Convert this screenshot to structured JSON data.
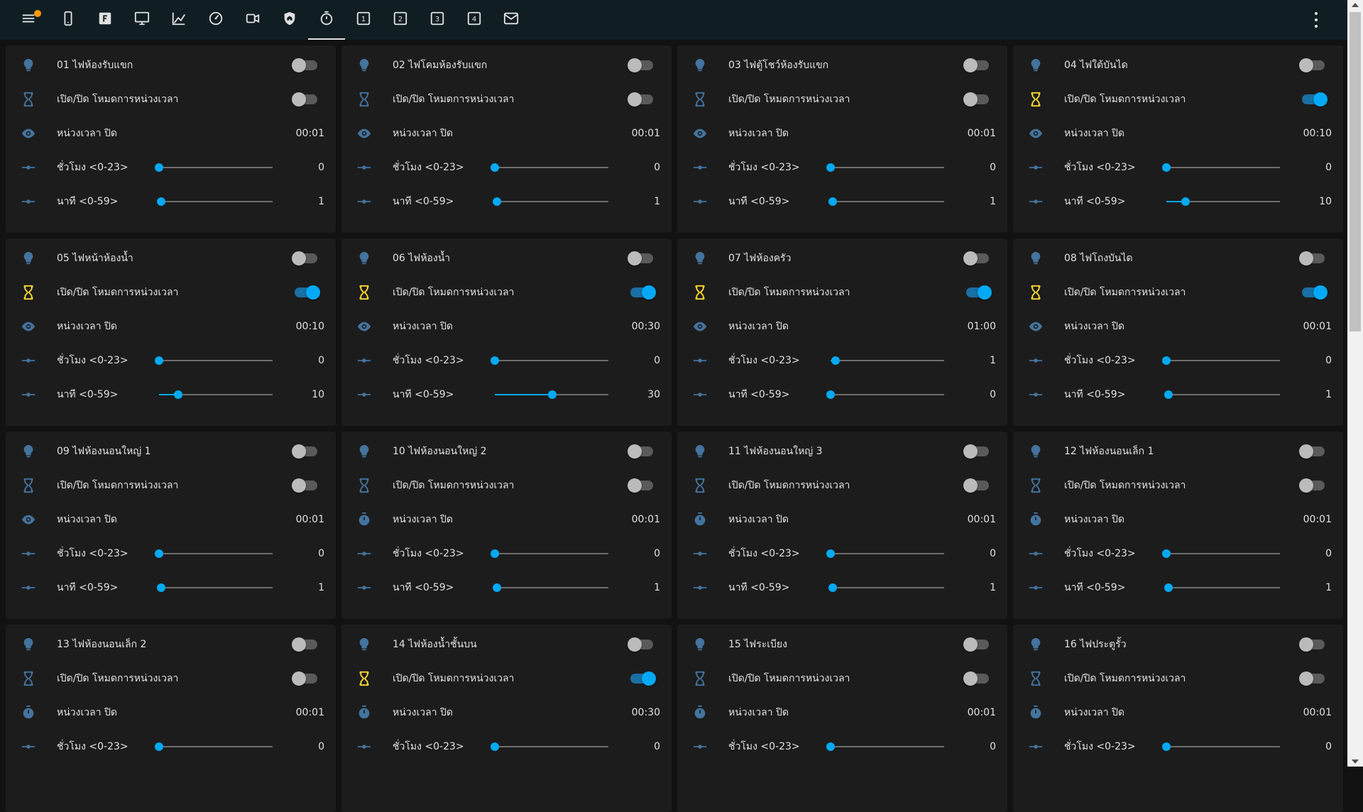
{
  "colors": {
    "accent": "#03a9f4",
    "icon": "#44739e",
    "icon_active": "#fdd835",
    "header_bg": "#101e24",
    "card_bg": "#1c1c1c"
  },
  "toolbar": {
    "menu_icon": "menu-icon",
    "tabs": [
      {
        "icon": "cellphone-icon"
      },
      {
        "icon": "alpha-f-box-icon"
      },
      {
        "icon": "monitor-icon"
      },
      {
        "icon": "chart-line-icon"
      },
      {
        "icon": "gauge-icon"
      },
      {
        "icon": "video-camera-icon"
      },
      {
        "icon": "shield-home-icon"
      },
      {
        "icon": "timer-icon",
        "active": true
      },
      {
        "icon": "numeric-1-box-icon",
        "digit": "1"
      },
      {
        "icon": "numeric-2-box-icon",
        "digit": "2"
      },
      {
        "icon": "numeric-3-box-icon",
        "digit": "3"
      },
      {
        "icon": "numeric-4-box-icon",
        "digit": "4"
      },
      {
        "icon": "email-icon"
      }
    ],
    "overflow_icon": "dots-vertical-icon"
  },
  "labels": {
    "timer_mode": "เปิด/ปิด โหมดการหน่วงเวลา",
    "delay_off": "หน่วงเวลา ปิด",
    "hours": "ชั่วโมง <0-23>",
    "minutes": "นาที <0-59>"
  },
  "cards": [
    {
      "title": "01 ไฟห้องรับแขก",
      "light_on": false,
      "timer_on": false,
      "delay_icon": "eye-icon",
      "delay": "00:01",
      "hours": 0,
      "minutes": 1
    },
    {
      "title": "02 ไฟโคมห้องรับแขก",
      "light_on": false,
      "timer_on": false,
      "delay_icon": "eye-icon",
      "delay": "00:01",
      "hours": 0,
      "minutes": 1
    },
    {
      "title": "03 ไฟตู้โชว์ห้องรับแขก",
      "light_on": false,
      "timer_on": false,
      "delay_icon": "eye-icon",
      "delay": "00:01",
      "hours": 0,
      "minutes": 1
    },
    {
      "title": "04 ไฟใต้บันได",
      "light_on": false,
      "timer_on": true,
      "delay_icon": "eye-icon",
      "delay": "00:10",
      "hours": 0,
      "minutes": 10
    },
    {
      "title": "05 ไฟหน้าห้องน้ำ",
      "light_on": false,
      "timer_on": true,
      "delay_icon": "eye-icon",
      "delay": "00:10",
      "hours": 0,
      "minutes": 10
    },
    {
      "title": "06 ไฟห้องน้ำ",
      "light_on": false,
      "timer_on": true,
      "delay_icon": "eye-icon",
      "delay": "00:30",
      "hours": 0,
      "minutes": 30
    },
    {
      "title": "07 ไฟห้องครัว",
      "light_on": false,
      "timer_on": true,
      "delay_icon": "eye-icon",
      "delay": "01:00",
      "hours": 1,
      "minutes": 0
    },
    {
      "title": "08 ไฟโถงบันได",
      "light_on": false,
      "timer_on": true,
      "delay_icon": "eye-icon",
      "delay": "00:01",
      "hours": 0,
      "minutes": 1
    },
    {
      "title": "09 ไฟห้องนอนใหญ่ 1",
      "light_on": false,
      "timer_on": false,
      "delay_icon": "eye-icon",
      "delay": "00:01",
      "hours": 0,
      "minutes": 1
    },
    {
      "title": "10 ไฟห้องนอนใหญ่ 2",
      "light_on": false,
      "timer_on": false,
      "delay_icon": "timer-icon",
      "delay": "00:01",
      "hours": 0,
      "minutes": 1
    },
    {
      "title": "11 ไฟห้องนอนใหญ่ 3",
      "light_on": false,
      "timer_on": false,
      "delay_icon": "timer-icon",
      "delay": "00:01",
      "hours": 0,
      "minutes": 1
    },
    {
      "title": "12 ไฟห้องนอนเล็ก 1",
      "light_on": false,
      "timer_on": false,
      "delay_icon": "timer-icon",
      "delay": "00:01",
      "hours": 0,
      "minutes": 1
    },
    {
      "title": "13 ไฟห้องนอนเล็ก 2",
      "light_on": false,
      "timer_on": false,
      "delay_icon": "timer-icon",
      "delay": "00:01",
      "hours": 0,
      "minutes": null
    },
    {
      "title": "14 ไฟห้องน้ำชั้นบน",
      "light_on": false,
      "timer_on": true,
      "delay_icon": "timer-icon",
      "delay": "00:30",
      "hours": 0,
      "minutes": null
    },
    {
      "title": "15 ไฟระเบียง",
      "light_on": false,
      "timer_on": false,
      "delay_icon": "timer-icon",
      "delay": "00:01",
      "hours": 0,
      "minutes": null
    },
    {
      "title": "16 ไฟประตูรั้ว",
      "light_on": false,
      "timer_on": false,
      "delay_icon": "timer-icon",
      "delay": "00:01",
      "hours": 0,
      "minutes": null
    }
  ]
}
